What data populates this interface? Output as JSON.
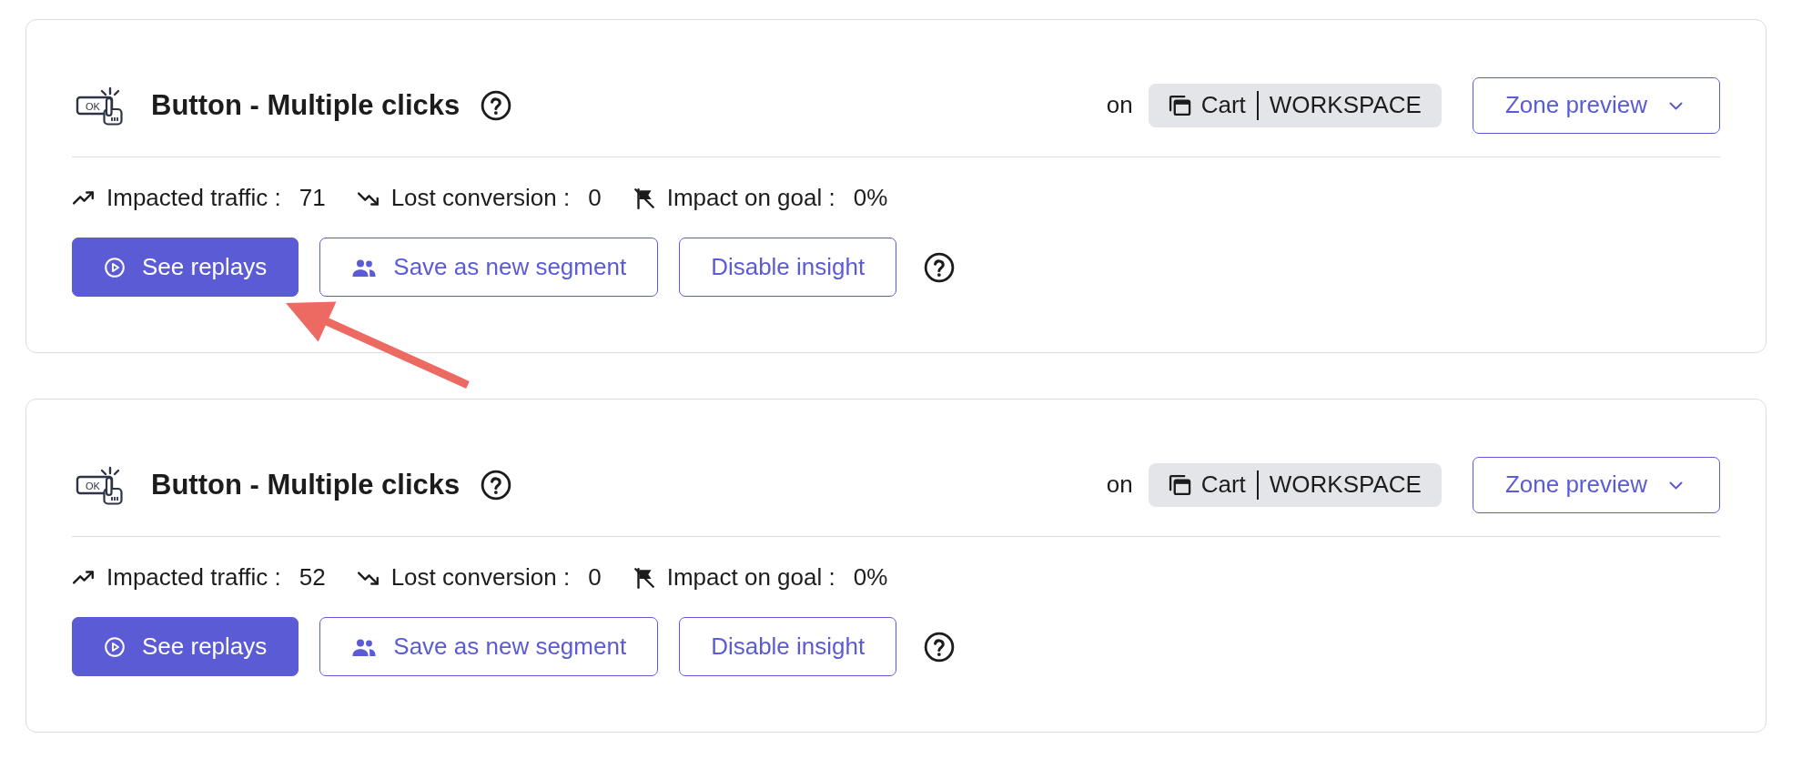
{
  "cards": [
    {
      "icon_label": "OK",
      "title": "Button - Multiple clicks",
      "on_label": "on",
      "location": {
        "page": "Cart",
        "scope": "WORKSPACE"
      },
      "zone_button": "Zone preview",
      "metrics": [
        {
          "kind": "traffic",
          "label": "Impacted traffic :",
          "value": "71"
        },
        {
          "kind": "conversion",
          "label": "Lost conversion :",
          "value": "0"
        },
        {
          "kind": "goal",
          "label": "Impact on goal :",
          "value": "0%"
        }
      ],
      "actions": [
        {
          "kind": "replays",
          "label": "See replays"
        },
        {
          "kind": "segment",
          "label": "Save as new segment"
        },
        {
          "kind": "disable",
          "label": "Disable insight"
        }
      ],
      "callout_arrow": true
    },
    {
      "icon_label": "OK",
      "title": "Button - Multiple clicks",
      "on_label": "on",
      "location": {
        "page": "Cart",
        "scope": "WORKSPACE"
      },
      "zone_button": "Zone preview",
      "metrics": [
        {
          "kind": "traffic",
          "label": "Impacted traffic :",
          "value": "52"
        },
        {
          "kind": "conversion",
          "label": "Lost conversion :",
          "value": "0"
        },
        {
          "kind": "goal",
          "label": "Impact on goal :",
          "value": "0%"
        }
      ],
      "actions": [
        {
          "kind": "replays",
          "label": "See replays"
        },
        {
          "kind": "segment",
          "label": "Save as new segment"
        },
        {
          "kind": "disable",
          "label": "Disable insight"
        }
      ],
      "callout_arrow": false
    }
  ]
}
